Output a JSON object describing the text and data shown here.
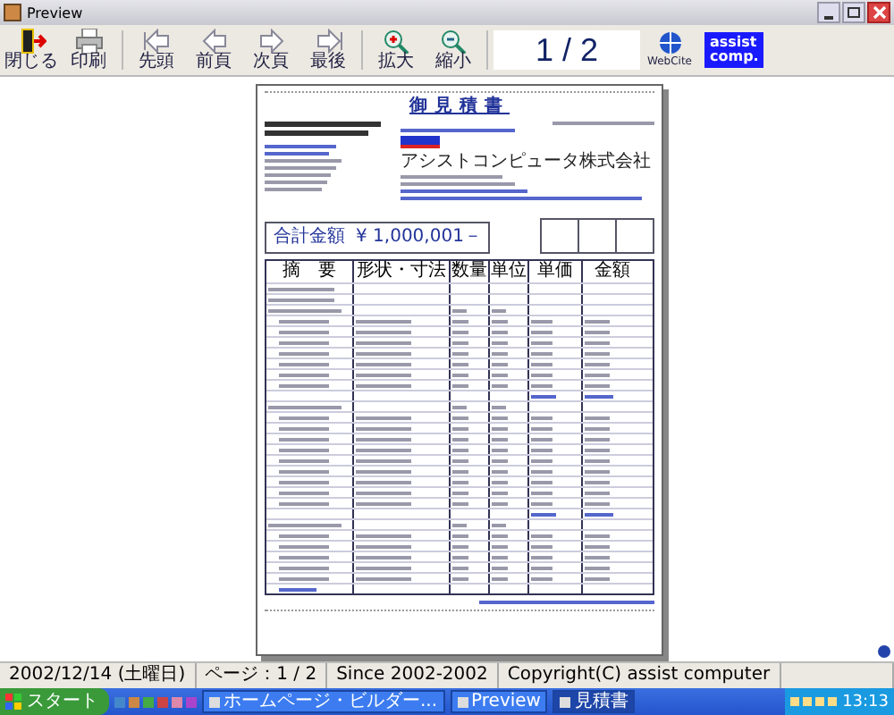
{
  "window": {
    "title": "Preview"
  },
  "toolbar": {
    "buttons": [
      {
        "label": "閉じる",
        "kind": "door"
      },
      {
        "label": "印刷",
        "kind": "printer"
      },
      {
        "label": "先頭",
        "kind": "first"
      },
      {
        "label": "前頁",
        "kind": "prev"
      },
      {
        "label": "次頁",
        "kind": "next"
      },
      {
        "label": "最後",
        "kind": "last"
      },
      {
        "label": "拡大",
        "kind": "zoomin"
      },
      {
        "label": "縮小",
        "kind": "zoomout"
      }
    ],
    "page_indicator": "1 / 2",
    "web_button": "WebCite",
    "logo": [
      "assist",
      "comp."
    ]
  },
  "document": {
    "title": "御見積書",
    "company": "アシストコンピュータ株式会社",
    "total_label": "合計金額",
    "total_value": "¥ 1,000,001－",
    "columns": [
      "摘　要",
      "形状・寸法",
      "数量",
      "単位",
      "単価",
      "金額"
    ],
    "rows": [
      {
        "kind": "note"
      },
      {
        "kind": "note"
      },
      {
        "kind": "section"
      },
      {
        "kind": "item"
      },
      {
        "kind": "item"
      },
      {
        "kind": "item"
      },
      {
        "kind": "item"
      },
      {
        "kind": "item"
      },
      {
        "kind": "item"
      },
      {
        "kind": "item"
      },
      {
        "kind": "subtotal"
      },
      {
        "kind": "section"
      },
      {
        "kind": "item"
      },
      {
        "kind": "item"
      },
      {
        "kind": "item"
      },
      {
        "kind": "item"
      },
      {
        "kind": "item"
      },
      {
        "kind": "item"
      },
      {
        "kind": "item"
      },
      {
        "kind": "item"
      },
      {
        "kind": "item"
      },
      {
        "kind": "subtotal"
      },
      {
        "kind": "section"
      },
      {
        "kind": "item"
      },
      {
        "kind": "item"
      },
      {
        "kind": "item"
      },
      {
        "kind": "item"
      },
      {
        "kind": "item"
      },
      {
        "kind": "end"
      }
    ]
  },
  "status_bar": [
    "2002/12/14 (土曜日)",
    "ページ：1 / 2",
    "Since 2002-2002",
    "Copyright(C) assist computer"
  ],
  "taskbar": {
    "start": "スタート",
    "tasks": [
      {
        "label": "ホームページ・ビルダー...",
        "selected": false
      },
      {
        "label": "Preview",
        "selected": false
      },
      {
        "label": "見積書",
        "selected": true
      }
    ],
    "clock": "13:13"
  }
}
